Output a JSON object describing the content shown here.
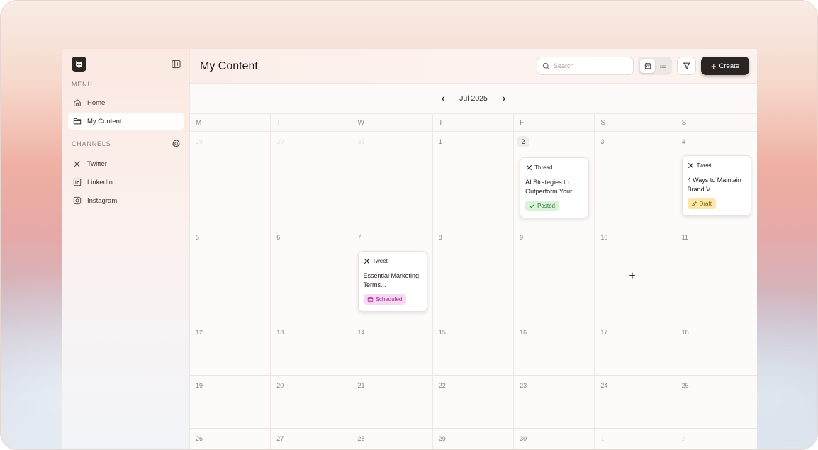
{
  "sidebar": {
    "menu_label": "MENU",
    "items": [
      {
        "label": "Home",
        "icon": "home-icon"
      },
      {
        "label": "My Content",
        "icon": "folder-icon",
        "active": true
      }
    ],
    "channels_label": "CHANNELS",
    "channels": [
      {
        "label": "Twitter",
        "icon": "x-logo-icon"
      },
      {
        "label": "LinkedIn",
        "icon": "linkedin-icon"
      },
      {
        "label": "Instagram",
        "icon": "instagram-icon"
      }
    ]
  },
  "header": {
    "title": "My Content",
    "search_placeholder": "Search",
    "create_label": "Create"
  },
  "calendar": {
    "month_label": "Jul 2025",
    "weekdays": [
      "M",
      "T",
      "W",
      "T",
      "F",
      "S",
      "S"
    ],
    "today": 2,
    "weeks": [
      [
        "29",
        "30",
        "31",
        "1",
        "2",
        "3",
        "4"
      ],
      [
        "5",
        "6",
        "7",
        "8",
        "9",
        "10",
        "11"
      ],
      [
        "12",
        "13",
        "14",
        "15",
        "16",
        "17",
        "18"
      ],
      [
        "19",
        "20",
        "21",
        "22",
        "23",
        "24",
        "25"
      ],
      [
        "26",
        "27",
        "28",
        "29",
        "30",
        "1",
        "2"
      ]
    ]
  },
  "posts": {
    "thread": {
      "type": "Thread",
      "title": "AI Strategies to Outperform Your...",
      "status": "Posted"
    },
    "tweet_draft": {
      "type": "Tweet",
      "title": "4 Ways to Maintain Brand V...",
      "status": "Draft"
    },
    "tweet_scheduled": {
      "type": "Tweet",
      "title": "Essential Marketing Terms...",
      "status": "Scheduled"
    }
  },
  "colors": {
    "accent_dark": "#2a2523",
    "posted": "#2f7a36",
    "draft": "#8a5b12",
    "scheduled": "#a02a93"
  }
}
